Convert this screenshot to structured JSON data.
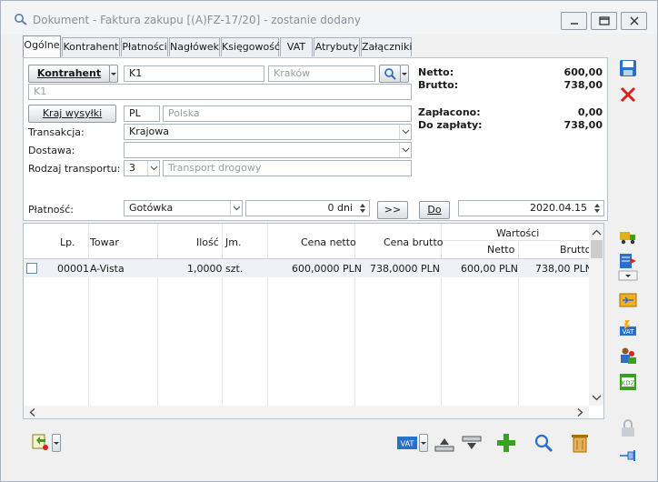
{
  "window": {
    "title": "Dokument - Faktura zakupu [(A)FZ-17/20]  - zostanie dodany"
  },
  "tabs": [
    "Ogólne",
    "Kontrahent",
    "Płatności",
    "Nagłówek",
    "Księgowość",
    "VAT",
    "Atrybuty",
    "Załączniki"
  ],
  "form": {
    "kontrahent_button": "Kontrahent",
    "kontrahent_code": "K1",
    "kontrahent_city_placeholder": "Kraków",
    "kontrahent_name": "K1",
    "kraj_button": "Kraj wysyłki",
    "kraj_code": "PL",
    "kraj_name": "Polska",
    "transakcja_label": "Transakcja:",
    "transakcja_value": "Krajowa",
    "dostawa_label": "Dostawa:",
    "dostawa_value": "",
    "rodzaj_label": "Rodzaj transportu:",
    "rodzaj_code": "3",
    "rodzaj_value": "Transport drogowy",
    "platnosc_label": "Płatność:",
    "platnosc_value": "Gotówka",
    "dni_value": "0 dni",
    "arrow_button": ">>",
    "do_button": "Do",
    "date_value": "2020.04.15"
  },
  "summary": {
    "netto_label": "Netto:",
    "netto_value": "600,00",
    "brutto_label": "Brutto:",
    "brutto_value": "738,00",
    "zaplacono_label": "Zapłacono:",
    "zaplacono_value": "0,00",
    "dozaplaty_label": "Do zapłaty:",
    "dozaplaty_value": "738,00"
  },
  "grid": {
    "headers": {
      "lp": "Lp.",
      "towar": "Towar",
      "ilosc": "Ilość",
      "jm": "Jm.",
      "cena_netto": "Cena netto",
      "cena_brutto": "Cena brutto",
      "wartosci": "Wartości",
      "netto": "Netto",
      "brutto": "Brutto"
    },
    "rows": [
      {
        "lp": "00001",
        "towar": "A-Vista",
        "ilosc": "1,0000",
        "jm": "szt.",
        "cena_netto": "600,0000 PLN",
        "cena_brutto": "738,0000 PLN",
        "netto": "600,00 PLN",
        "brutto": "738,00 PLN"
      }
    ]
  },
  "icons": {
    "save": "save-icon",
    "cancel": "cancel-icon",
    "delivery": "truck-icon",
    "export": "export-icon",
    "convert": "convert-icon",
    "vat": "vat-icon",
    "users": "users-icon",
    "kdz": "kdz-icon",
    "lock": "lock-icon",
    "pin": "pin-icon",
    "add": "add-icon",
    "search": "search-icon",
    "delete": "trash-icon",
    "accent_green": "#3aa020",
    "accent_red": "#d9231f",
    "accent_blue": "#2a6fc9"
  }
}
